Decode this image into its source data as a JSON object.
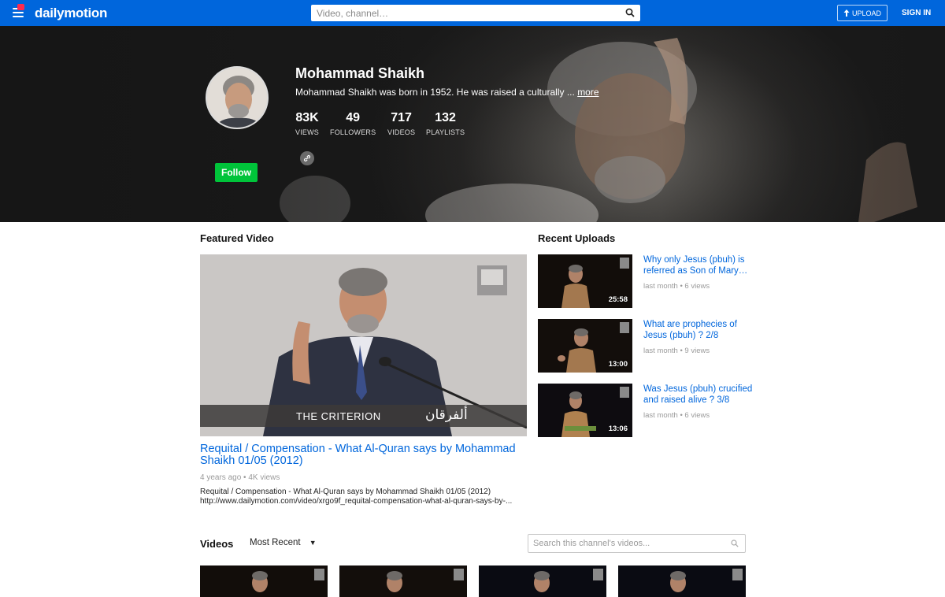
{
  "header": {
    "logo_text": "dailymotion",
    "search_placeholder": "Video, channel…",
    "upload_label": "UPLOAD",
    "signin_label": "SIGN IN"
  },
  "channel": {
    "name": "Mohammad Shaikh",
    "description": "Mohammad Shaikh was born in 1952. He was raised a culturally ...",
    "more_label": "more",
    "follow_label": "Follow",
    "stats": [
      {
        "value": "83K",
        "label": "VIEWS"
      },
      {
        "value": "49",
        "label": "FOLLOWERS"
      },
      {
        "value": "717",
        "label": "VIDEOS"
      },
      {
        "value": "132",
        "label": "PLAYLISTS"
      }
    ]
  },
  "featured": {
    "section_title": "Featured Video",
    "title": "Requital / Compensation - What Al-Quran says by Mohammad Shaikh 01/05 (2012)",
    "meta": "4 years ago • 4K views",
    "description_line1": "Requital / Compensation - What Al-Quran says by Mohammad Shaikh 01/05 (2012)",
    "description_line2": "http://www.dailymotion.com/video/xrgo9f_requital-compensation-what-al-quran-says-by-...",
    "overlay_text": "THE CRITERION",
    "overlay_arabic": "ألفرقان"
  },
  "recent": {
    "section_title": "Recent Uploads",
    "items": [
      {
        "title": "Why only Jesus (pbuh) is referred as Son of Mary…",
        "meta": "last month • 6 views",
        "duration": "25:58"
      },
      {
        "title": "What are prophecies of Jesus (pbuh) ? 2/8",
        "meta": "last month • 9 views",
        "duration": "13:00"
      },
      {
        "title": "Was Jesus (pbuh) crucified and raised alive ? 3/8",
        "meta": "last month • 6 views",
        "duration": "13:06"
      }
    ]
  },
  "videos": {
    "section_title": "Videos",
    "sort_value": "Most Recent",
    "search_placeholder": "Search this channel's videos..."
  },
  "colors": {
    "brand": "#0066dc",
    "follow": "#00c43a",
    "link": "#0066dc"
  }
}
